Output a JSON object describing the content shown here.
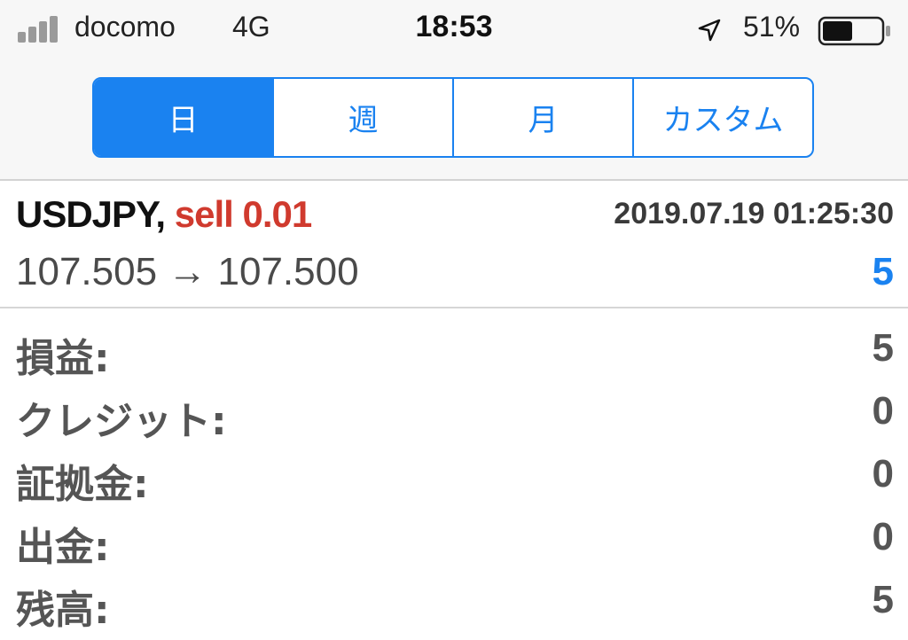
{
  "status_bar": {
    "carrier": "docomo",
    "network": "4G",
    "time": "18:53",
    "battery_percent": "51%",
    "battery_level": 0.51,
    "location_icon": "location-arrow-icon",
    "signal_icon": "signal-bars-icon",
    "battery_icon": "battery-icon"
  },
  "segments": [
    {
      "label": "日",
      "active": true
    },
    {
      "label": "週",
      "active": false
    },
    {
      "label": "月",
      "active": false
    },
    {
      "label": "カスタム",
      "active": false
    }
  ],
  "trade": {
    "symbol": "USDJPY,",
    "type_label": "sell 0.01",
    "timestamp": "2019.07.19 01:25:30",
    "prices": "107.505 → 107.500",
    "profit": "5"
  },
  "summary": [
    {
      "label": "損益:",
      "value": "5"
    },
    {
      "label": "クレジット:",
      "value": "0"
    },
    {
      "label": "証拠金:",
      "value": "0"
    },
    {
      "label": "出金:",
      "value": "0"
    },
    {
      "label": "残高:",
      "value": "5"
    }
  ],
  "colors": {
    "accent": "#1a82f0",
    "sell": "#d03a2e",
    "background_top": "#f7f7f7"
  }
}
